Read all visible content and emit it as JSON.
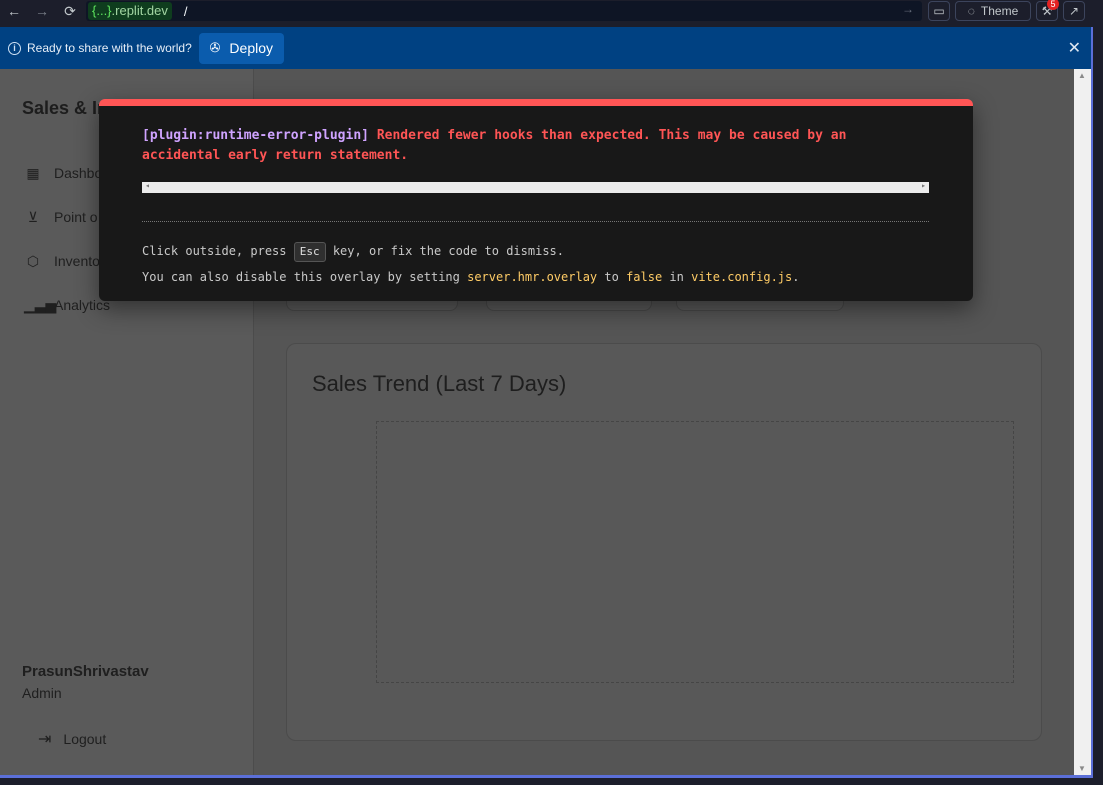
{
  "browser": {
    "url_host": "{...}",
    "url_host_suffix": ".replit.dev",
    "url_path": "/",
    "theme_label": "Theme",
    "badge_count": "5"
  },
  "deploy_banner": {
    "message": "Ready to share with the world?",
    "deploy_label": "Deploy"
  },
  "sidebar": {
    "brand": "Sales & In",
    "items": [
      {
        "label": "Dashbo",
        "icon": "grid-icon"
      },
      {
        "label": "Point o",
        "icon": "cart-icon"
      },
      {
        "label": "Invento",
        "icon": "box-icon"
      },
      {
        "label": "Analytics",
        "icon": "bar-chart-icon"
      }
    ],
    "user_name": "PrasunShrivastav",
    "user_role": "Admin",
    "logout_label": "Logout"
  },
  "main": {
    "chart_title": "Sales Trend (Last 7 Days)"
  },
  "error_overlay": {
    "plugin": "[plugin:runtime-error-plugin]",
    "message": "Rendered fewer hooks than expected. This may be caused by an accidental early return statement.",
    "tip1_before": "Click outside, press ",
    "tip1_key": "Esc",
    "tip1_after": " key, or fix the code to dismiss.",
    "tip2_a": "You can also disable this overlay by setting ",
    "tip2_code1": "server.hmr.overlay",
    "tip2_b": " to ",
    "tip2_code2": "false",
    "tip2_c": " in ",
    "tip2_code3": "vite.config.js",
    "tip2_d": "."
  },
  "colors": {
    "error_accent": "#ff5555",
    "banner": "#004182",
    "plugin": "#cfa3ff",
    "code": "#ffcc66"
  }
}
